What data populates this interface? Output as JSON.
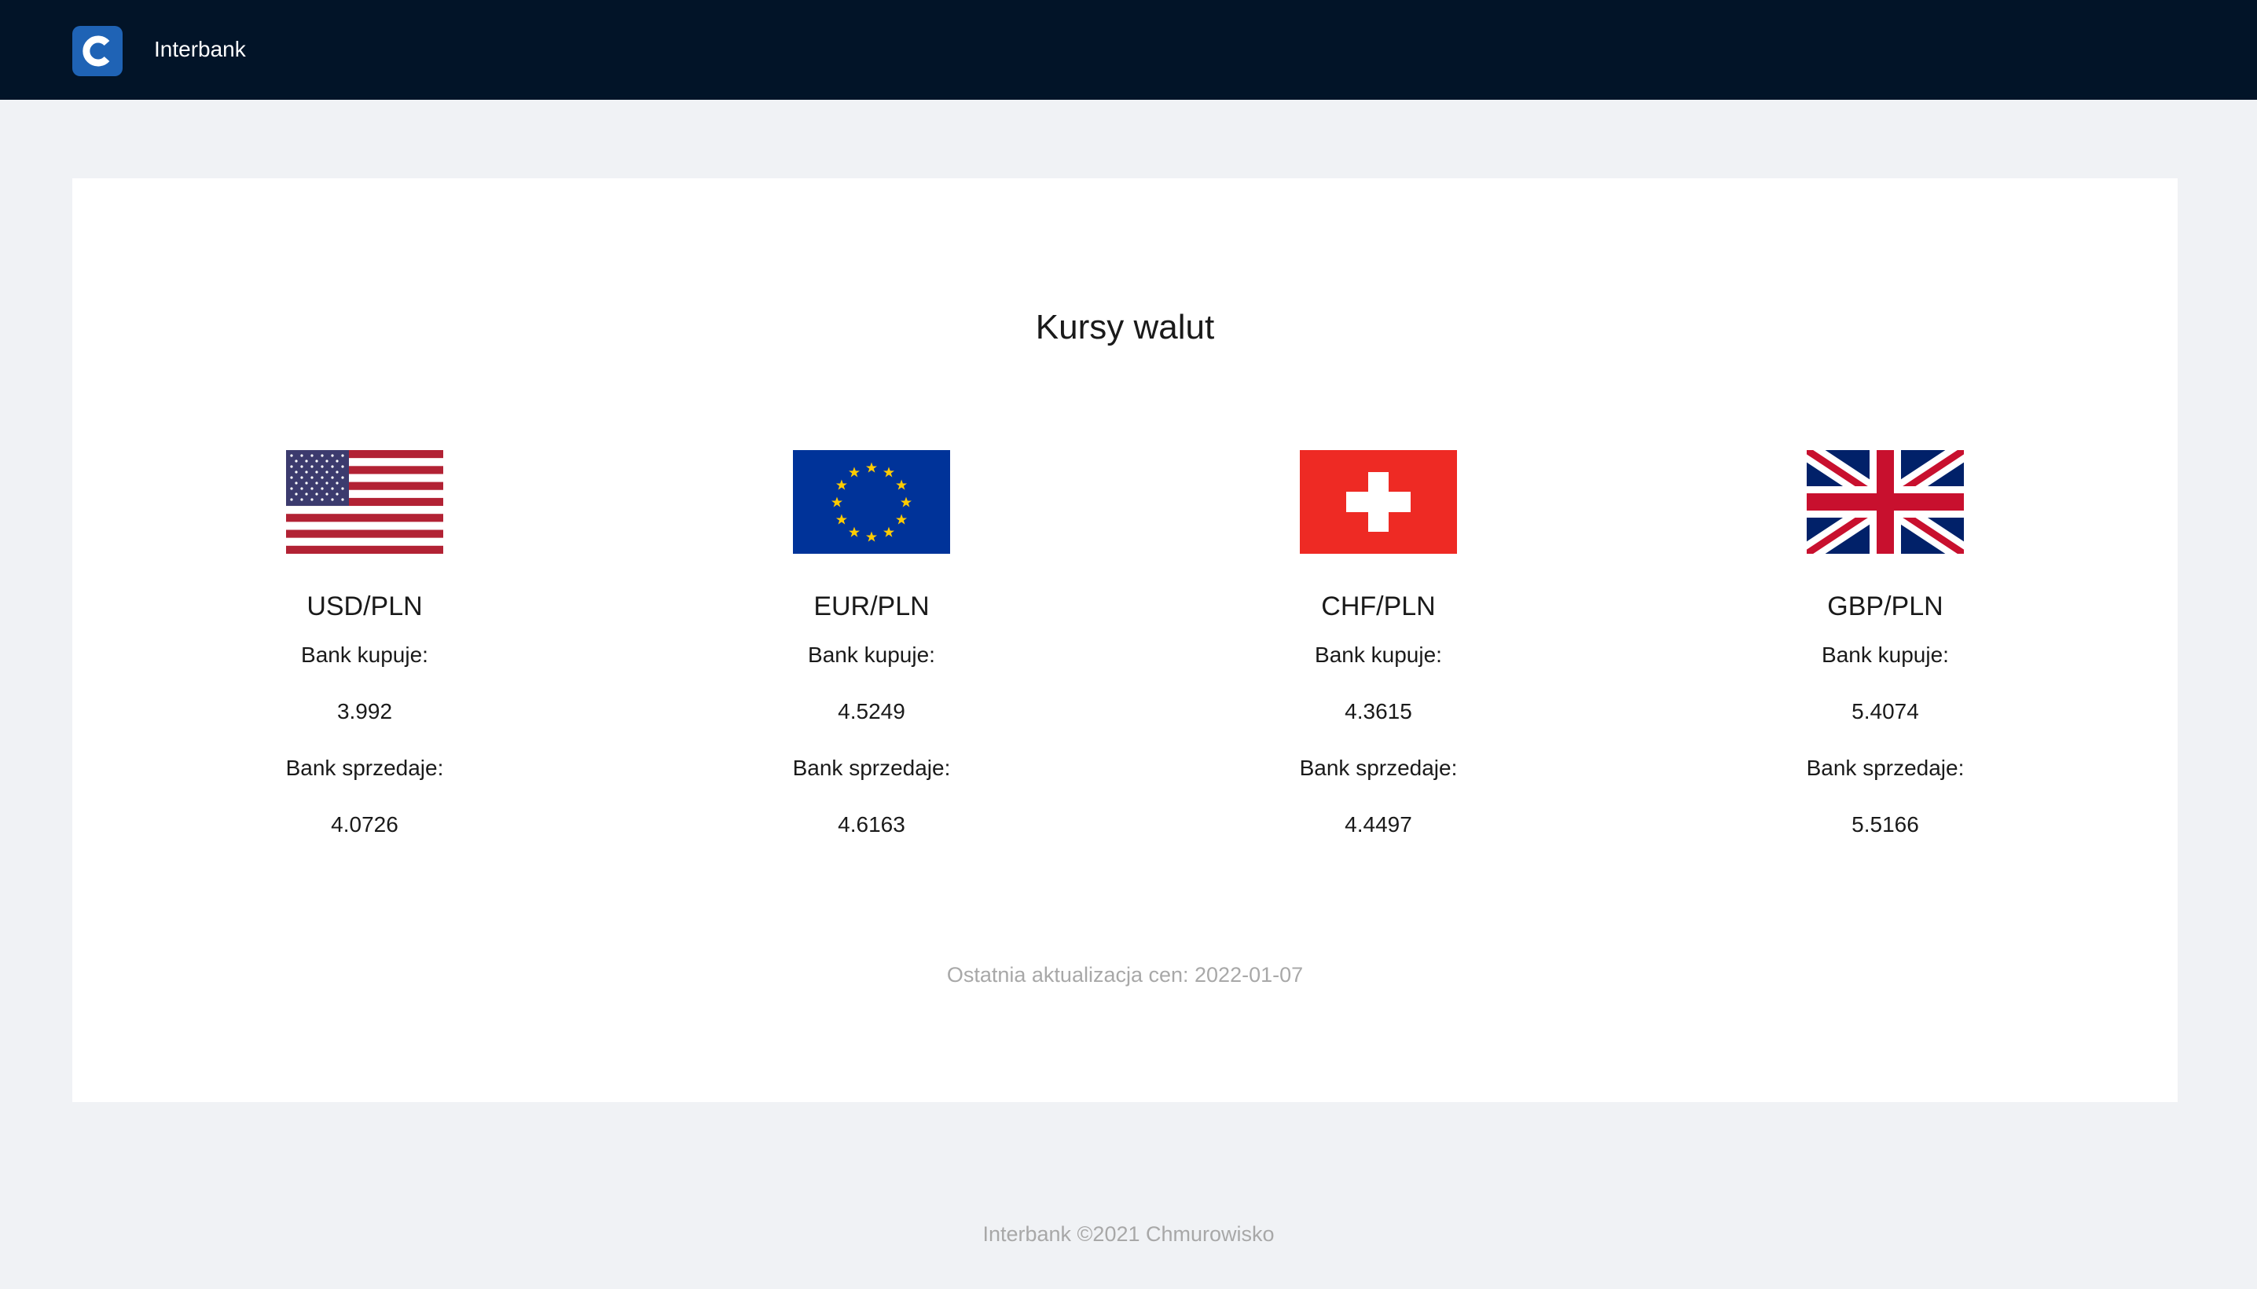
{
  "header": {
    "logo_letter": "C",
    "title": "Interbank",
    "background": "#021428",
    "logo_color": "#1f63b5"
  },
  "main": {
    "title": "Kursy walut",
    "currencies": [
      {
        "flag": "us-flag-icon",
        "pair": "USD/PLN",
        "buy_label": "Bank kupuje:",
        "buy": "3.992",
        "sell_label": "Bank sprzedaje:",
        "sell": "4.0726"
      },
      {
        "flag": "eu-flag-icon",
        "pair": "EUR/PLN",
        "buy_label": "Bank kupuje:",
        "buy": "4.5249",
        "sell_label": "Bank sprzedaje:",
        "sell": "4.6163"
      },
      {
        "flag": "ch-flag-icon",
        "pair": "CHF/PLN",
        "buy_label": "Bank kupuje:",
        "buy": "4.3615",
        "sell_label": "Bank sprzedaje:",
        "sell": "4.4497"
      },
      {
        "flag": "gb-flag-icon",
        "pair": "GBP/PLN",
        "buy_label": "Bank kupuje:",
        "buy": "5.4074",
        "sell_label": "Bank sprzedaje:",
        "sell": "5.5166"
      }
    ],
    "last_update": "Ostatnia aktualizacja cen: 2022-01-07"
  },
  "footer": {
    "text": "Interbank ©2021 Chmurowisko"
  }
}
